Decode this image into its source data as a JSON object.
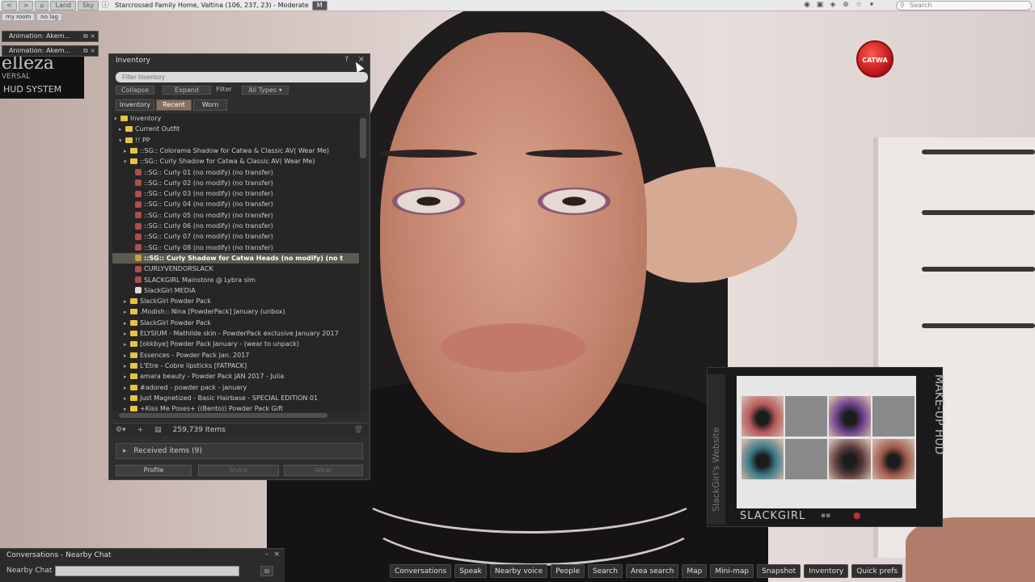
{
  "topbar": {
    "back_label": "<",
    "forward_label": ">",
    "land_label": "Land",
    "home_icon": "home-icon",
    "sky_label": "Sky",
    "location": "Starcrossed Family Home, Valtina (106, 237, 23) - Moderate",
    "rating_badge": "M",
    "search_placeholder": "Search",
    "subtags": [
      "my room",
      "no lag"
    ]
  },
  "notices": [
    {
      "text": "Animation: Akem..."
    },
    {
      "text": "Animation: Akem..."
    }
  ],
  "belleza_hud": {
    "line1": "elleza",
    "line2": "VERSAL",
    "line3": "HUD SYSTEM"
  },
  "catwa_badge": "CATWA",
  "inventory": {
    "title": "Inventory",
    "help": "?",
    "close": "×",
    "filter_placeholder": "Filter Inventory",
    "collapse": "Collapse",
    "expand": "Expand",
    "filter": "Filter",
    "types": "All Types",
    "tabs": [
      {
        "label": "Inventory"
      },
      {
        "label": "Recent"
      },
      {
        "label": "Worn"
      }
    ],
    "active_tab": "Recent",
    "tree": [
      {
        "label": "Inventory",
        "depth": 0,
        "kind": "folder",
        "open": true
      },
      {
        "label": "Current Outfit",
        "depth": 1,
        "kind": "folder",
        "open": false
      },
      {
        "label": "!!                    PP",
        "depth": 1,
        "kind": "folder",
        "open": true
      },
      {
        "label": "::SG:: Colorama Shadow for Catwa & Classic AV( Wear Me)",
        "depth": 2,
        "kind": "folder",
        "open": false
      },
      {
        "label": "::SG:: Curly Shadow for Catwa & Classic AV( Wear Me)",
        "depth": 2,
        "kind": "folder",
        "open": true
      },
      {
        "label": "::SG:: Curly 01 (no modify) (no transfer)",
        "depth": 3,
        "kind": "item"
      },
      {
        "label": "::SG:: Curly 02 (no modify) (no transfer)",
        "depth": 3,
        "kind": "item"
      },
      {
        "label": "::SG:: Curly 03 (no modify) (no transfer)",
        "depth": 3,
        "kind": "item"
      },
      {
        "label": "::SG:: Curly 04 (no modify) (no transfer)",
        "depth": 3,
        "kind": "item"
      },
      {
        "label": "::SG:: Curly 05 (no modify) (no transfer)",
        "depth": 3,
        "kind": "item"
      },
      {
        "label": "::SG:: Curly 06 (no modify) (no transfer)",
        "depth": 3,
        "kind": "item"
      },
      {
        "label": "::SG:: Curly 07 (no modify) (no transfer)",
        "depth": 3,
        "kind": "item"
      },
      {
        "label": "::SG:: Curly 08 (no modify) (no transfer)",
        "depth": 3,
        "kind": "item"
      },
      {
        "label": "::SG:: Curly Shadow for Catwa Heads (no modify) (no t",
        "depth": 3,
        "kind": "object",
        "selected": true
      },
      {
        "label": "CURLYVENDORSLACK",
        "depth": 3,
        "kind": "item"
      },
      {
        "label": "SLACKGIRL Mainstore @ Lybra sim",
        "depth": 3,
        "kind": "item"
      },
      {
        "label": "SlackGirl MEDIA",
        "depth": 3,
        "kind": "note"
      },
      {
        "label": "SlackGirl Powder Pack",
        "depth": 2,
        "kind": "folder",
        "open": false
      },
      {
        "label": ".Modish:: Nina [PowderPack] January (unbox)",
        "depth": 2,
        "kind": "folder",
        "open": false
      },
      {
        "label": "SlackGirl Powder Pack",
        "depth": 2,
        "kind": "folder",
        "open": false
      },
      {
        "label": "ELYSIUM - Mathilde skin - PowderPack exclusive January 2017",
        "depth": 2,
        "kind": "folder",
        "open": false
      },
      {
        "label": "[okkbye] Powder Pack January - (wear to unpack)",
        "depth": 2,
        "kind": "folder",
        "open": false
      },
      {
        "label": "Essences - Powder Pack Jan. 2017",
        "depth": 2,
        "kind": "folder",
        "open": false
      },
      {
        "label": "L'Etre - Cobre lipsticks [FATPACK]",
        "depth": 2,
        "kind": "folder",
        "open": false
      },
      {
        "label": "amara beauty - Powder Pack JAN 2017 - Julia",
        "depth": 2,
        "kind": "folder",
        "open": false
      },
      {
        "label": "#adored - powder pack - january",
        "depth": 2,
        "kind": "folder",
        "open": false
      },
      {
        "label": "Just Magnetized - Basic Hairbase - SPECIAL EDITION 01",
        "depth": 2,
        "kind": "folder",
        "open": false
      },
      {
        "label": "+Kiss Me Poses+ ((Bento)) Powder Pack Gift",
        "depth": 2,
        "kind": "folder",
        "open": false
      }
    ],
    "item_count": "259,739 Items",
    "received": "Received items (9)",
    "profile": "Profile",
    "share": "Share",
    "wear": "Wear"
  },
  "makeup_hud": {
    "side_label": "SlackGirl's Website",
    "vertical_title": "MAKE-UP HUD",
    "brand": "SLACKGIRL",
    "swatch_colors": [
      "#b8585a",
      "#8a8a8a",
      "#6a3f8a",
      "#8a8a8a",
      "#3a7a86",
      "#8a8a8a",
      "#5a3a3a",
      "#a05a4a"
    ]
  },
  "conversations": {
    "title": "Conversations - Nearby Chat",
    "minimize": "–",
    "close": "×",
    "nearby_label": "Nearby Chat"
  },
  "bottombar": [
    "Conversations",
    "Speak",
    "Nearby voice",
    "People",
    "Search",
    "Area search",
    "Map",
    "Mini-map",
    "Snapshot",
    "Inventory",
    "Quick prefs"
  ],
  "colors": {
    "accent_tab": "#8a6e5a",
    "folder": "#e8c341",
    "selected_row": "#5d5a52"
  }
}
